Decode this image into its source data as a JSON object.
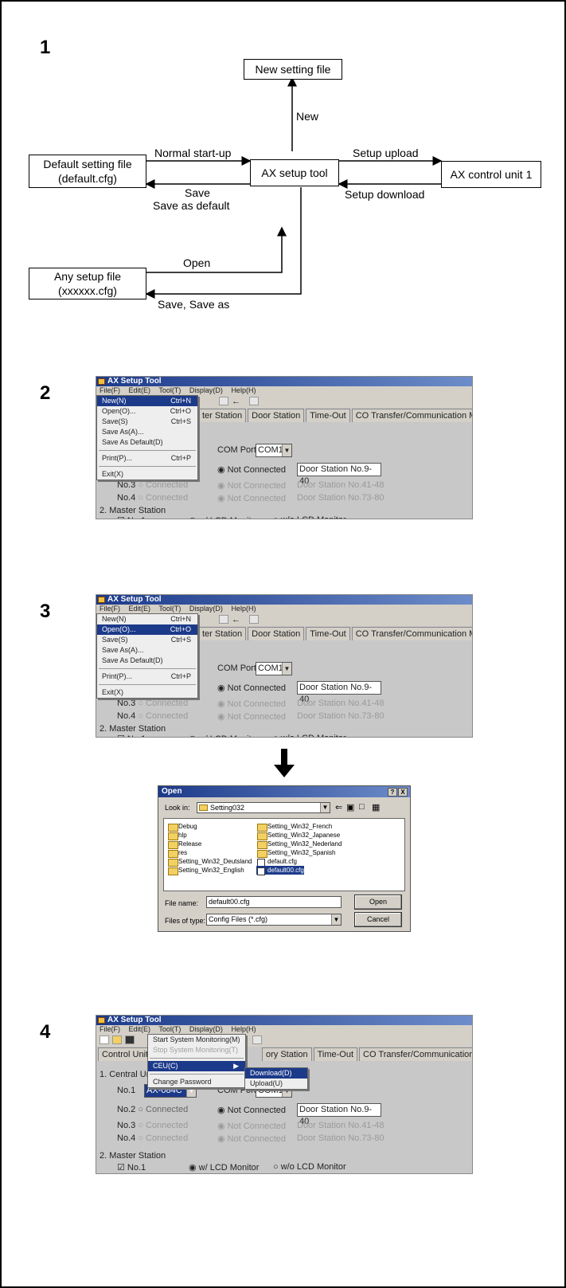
{
  "steps": {
    "s1": "1",
    "s2": "2",
    "s3": "3",
    "s4": "4"
  },
  "diagram": {
    "new_setting_file": "New setting file",
    "new_label": "New",
    "default_file_line1": "Default setting file",
    "default_file_line2": "(default.cfg)",
    "normal_startup": "Normal start-up",
    "save": "Save",
    "save_as_default": "Save as default",
    "ax_setup_tool": "AX setup tool",
    "setup_upload": "Setup upload",
    "setup_download": "Setup download",
    "ax_control_unit": "AX control unit 1",
    "any_file_line1": "Any setup file",
    "any_file_line2": "(xxxxxx.cfg)",
    "open": "Open",
    "save_save_as": "Save, Save as"
  },
  "app": {
    "title": "AX Setup Tool",
    "menus": [
      "File(F)",
      "Edit(E)",
      "Tool(T)",
      "Display(D)",
      "Help(H)"
    ],
    "tabs": [
      "ter Station",
      "Door Station",
      "Time-Out",
      "CO Transfer/Communication Method"
    ],
    "tabs4": [
      "Control Unit",
      "ory Station",
      "Time-Out",
      "CO Transfer/Communication Method"
    ],
    "com_port_label": "COM Port",
    "com_port_value": "COM1",
    "not_connected": "Not Connected",
    "door_station_no": "Door Station No.9-40",
    "no3": "No.3",
    "no4": "No.4",
    "no2": "No.2",
    "no1": "No.1",
    "connected": "Connected",
    "door_station_dim_a": "Door Station No.41-48",
    "door_station_dim_b": "Door Station No.73-80",
    "master_station": "2. Master Station",
    "master_no1": "No.1",
    "w_lcd": "w/ LCD Monitor",
    "wo_lcd": "w/o LCD Monitor",
    "central_unit": "1. Central Unit",
    "unit_value": "AX-084C"
  },
  "file_menu": {
    "items": [
      {
        "label": "New(N)",
        "shortcut": "Ctrl+N"
      },
      {
        "label": "Open(O)...",
        "shortcut": "Ctrl+O"
      },
      {
        "label": "Save(S)",
        "shortcut": "Ctrl+S"
      },
      {
        "label": "Save As(A)...",
        "shortcut": ""
      },
      {
        "label": "Save As Default(D)",
        "shortcut": ""
      },
      {
        "label": "Print(P)...",
        "shortcut": "Ctrl+P"
      },
      {
        "label": "Exit(X)",
        "shortcut": ""
      }
    ]
  },
  "tool_menu": {
    "items": [
      {
        "label": "Start System Monitoring(M)"
      },
      {
        "label": "Stop System Monitoring(T)"
      },
      {
        "label": "CEU(C)"
      },
      {
        "label": "Change Password"
      }
    ],
    "submenu": [
      "Download(D)",
      "Upload(U)"
    ]
  },
  "open_dialog": {
    "title": "Open",
    "help_btn": "?",
    "close_btn": "X",
    "look_in_label": "Look in:",
    "look_in_value": "Setting032",
    "folders_left": [
      "Debug",
      "hlp",
      "Release",
      "res",
      "Setting_Win32_Deutsland",
      "Setting_Win32_English"
    ],
    "folders_right": [
      "Setting_Win32_French",
      "Setting_Win32_Japanese",
      "Setting_Win32_Nederland",
      "Setting_Win32_Spanish"
    ],
    "files_right": [
      "default.cfg",
      "default00.cfg"
    ],
    "file_name_label": "File name:",
    "file_name_value": "default00.cfg",
    "files_of_type_label": "Files of type:",
    "files_of_type_value": "Config Files (*.cfg)",
    "open_btn": "Open",
    "cancel_btn": "Cancel"
  }
}
